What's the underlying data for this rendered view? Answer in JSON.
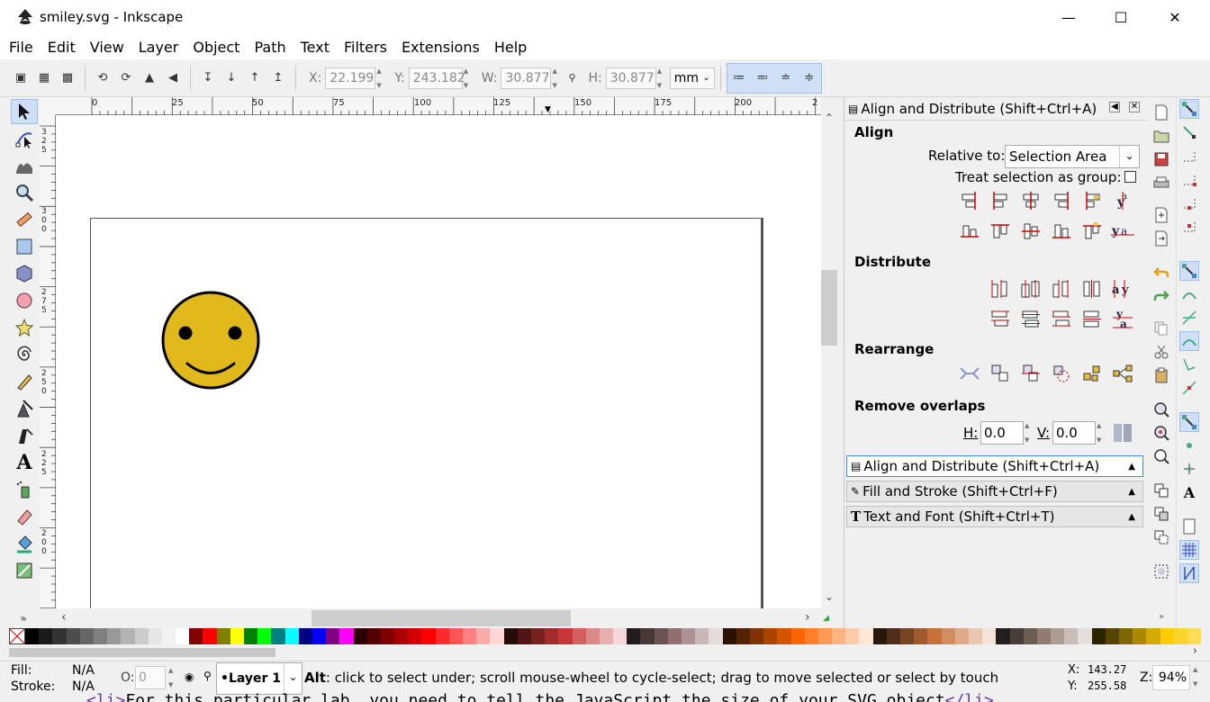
{
  "window": {
    "title": "smiley.svg - Inkscape"
  },
  "menu": [
    "File",
    "Edit",
    "View",
    "Layer",
    "Object",
    "Path",
    "Text",
    "Filters",
    "Extensions",
    "Help"
  ],
  "toolbar": {
    "x_label": "X:",
    "x_value": "22.199",
    "y_label": "Y:",
    "y_value": "243.182",
    "w_label": "W:",
    "w_value": "30.877",
    "h_label": "H:",
    "h_value": "30.877",
    "unit": "mm"
  },
  "ruler": {
    "top_labels": [
      "0",
      "25",
      "50",
      "75",
      "100",
      "125",
      "150",
      "175",
      "200",
      "2"
    ],
    "left_labels": [
      "3\n2\n5",
      "3\n0\n0",
      "2\n7\n5",
      "2\n5\n0",
      "2\n2\n5",
      "2\n0\n0"
    ]
  },
  "smiley": {
    "face_color": "#e2b91b",
    "outline_color": "#000000"
  },
  "dock": {
    "header": "Align and Distribute (Shift+Ctrl+A)",
    "align_title": "Align",
    "relative_to_label": "Relative to:",
    "relative_to_value": "Selection Area",
    "treat_group_label": "Treat selection as group:",
    "distribute_title": "Distribute",
    "rearrange_title": "Rearrange",
    "remove_overlaps_title": "Remove overlaps",
    "h_label": "H:",
    "h_value": "0.0",
    "v_label": "V:",
    "v_value": "0.0",
    "tabs": [
      {
        "label": "Align and Distribute (Shift+Ctrl+A)"
      },
      {
        "label": "Fill and Stroke (Shift+Ctrl+F)"
      },
      {
        "label": "Text and Font (Shift+Ctrl+T)"
      }
    ]
  },
  "palette_colors": [
    "#000000",
    "#1a1a1a",
    "#333333",
    "#4d4d4d",
    "#666666",
    "#808080",
    "#999999",
    "#b3b3b3",
    "#cccccc",
    "#e6e6e6",
    "#f2f2f2",
    "#ffffff",
    "#800000",
    "#ff0000",
    "#808000",
    "#ffff00",
    "#008000",
    "#00ff00",
    "#008080",
    "#00ffff",
    "#000080",
    "#0000ff",
    "#800080",
    "#ff00ff",
    "#2b0000",
    "#550000",
    "#800000",
    "#aa0000",
    "#d40000",
    "#ff0000",
    "#ff2a2a",
    "#ff5555",
    "#ff8080",
    "#ffaaaa",
    "#ffd5d5",
    "#280b0b",
    "#501616",
    "#782121",
    "#a02c2c",
    "#c83737",
    "#d35f5f",
    "#de8787",
    "#e9afaf",
    "#f4d7d7",
    "#241c1c",
    "#483737",
    "#6c5353",
    "#916f6f",
    "#ac9393",
    "#c8b7b7",
    "#e3dbdb",
    "#2b1100",
    "#552200",
    "#803300",
    "#aa4400",
    "#d45500",
    "#ff6600",
    "#ff7f2a",
    "#ff9955",
    "#ffb380",
    "#ffccaa",
    "#ffe6d5",
    "#28170b",
    "#502d16",
    "#784421",
    "#a05a2c",
    "#c87137",
    "#d38d5f",
    "#deaa87",
    "#e9c6af",
    "#f4e3d7",
    "#241f1c",
    "#483e37",
    "#6c5d53",
    "#917c6f",
    "#ac9d93",
    "#c8beb7",
    "#e3dedb",
    "#2b2200",
    "#554400",
    "#806600",
    "#aa8800",
    "#d4aa00",
    "#ffcc00",
    "#ffd42a",
    "#ffdd55"
  ],
  "status": {
    "fill_label": "Fill:",
    "fill_value": "N/A",
    "stroke_label": "Stroke:",
    "stroke_value": "N/A",
    "opacity_label": "O:",
    "opacity_value": "0",
    "layer": "•Layer 1",
    "message_bold": "Alt",
    "message": ": click to select under; scroll mouse-wheel to cycle-select; drag to move selected or select by touch",
    "x_label": "X:",
    "x_value": "143.27",
    "y_label": "Y:",
    "y_value": "255.58",
    "zoom_label": "Z:",
    "zoom_value": "94%"
  },
  "background_text": {
    "open_tag": "<li>",
    "text": "For this particular lab, you need to tell the JavaScript the size of your SVG object",
    "close_tag": "</li>"
  }
}
